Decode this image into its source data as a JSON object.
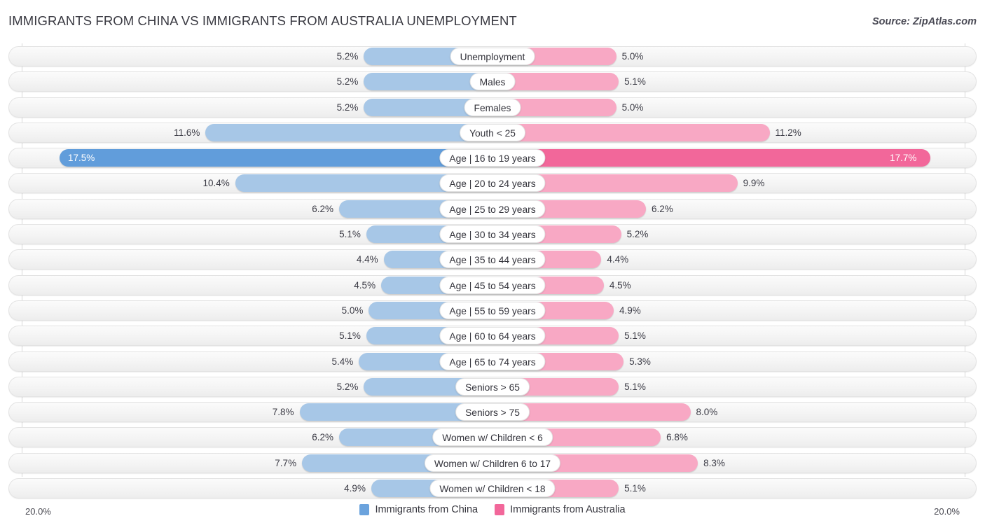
{
  "header": {
    "title": "IMMIGRANTS FROM CHINA VS IMMIGRANTS FROM AUSTRALIA UNEMPLOYMENT",
    "source": "Source: ZipAtlas.com"
  },
  "axis": {
    "left_label": "20.0%",
    "right_label": "20.0%",
    "max": 20.0
  },
  "legend": {
    "items": [
      {
        "label": "Immigrants from China",
        "color": "#6ba3dd"
      },
      {
        "label": "Immigrants from Australia",
        "color": "#f2679a"
      }
    ]
  },
  "colors": {
    "left_normal": "#a7c7e7",
    "left_highlight": "#619ddb",
    "right_normal": "#f8a8c4",
    "right_highlight": "#f2679a",
    "track": "#f4f4f4",
    "gridline": "#d7d7d7"
  },
  "chart_data": {
    "type": "bar",
    "orientation": "horizontal-diverging",
    "title": "IMMIGRANTS FROM CHINA VS IMMIGRANTS FROM AUSTRALIA UNEMPLOYMENT",
    "xlabel": "",
    "ylabel": "",
    "xlim": [
      0,
      20.0
    ],
    "grid": true,
    "legend_position": "bottom-center",
    "categories": [
      "Unemployment",
      "Males",
      "Females",
      "Youth < 25",
      "Age | 16 to 19 years",
      "Age | 20 to 24 years",
      "Age | 25 to 29 years",
      "Age | 30 to 34 years",
      "Age | 35 to 44 years",
      "Age | 45 to 54 years",
      "Age | 55 to 59 years",
      "Age | 60 to 64 years",
      "Age | 65 to 74 years",
      "Seniors > 65",
      "Seniors > 75",
      "Women w/ Children < 6",
      "Women w/ Children 6 to 17",
      "Women w/ Children < 18"
    ],
    "series": [
      {
        "name": "Immigrants from China",
        "values": [
          5.2,
          5.2,
          5.2,
          11.6,
          17.5,
          10.4,
          6.2,
          5.1,
          4.4,
          4.5,
          5.0,
          5.1,
          5.4,
          5.2,
          7.8,
          6.2,
          7.7,
          4.9
        ],
        "labels": [
          "5.2%",
          "5.2%",
          "5.2%",
          "11.6%",
          "17.5%",
          "10.4%",
          "6.2%",
          "5.1%",
          "4.4%",
          "4.5%",
          "5.0%",
          "5.1%",
          "5.4%",
          "5.2%",
          "7.8%",
          "6.2%",
          "7.7%",
          "4.9%"
        ]
      },
      {
        "name": "Immigrants from Australia",
        "values": [
          5.0,
          5.1,
          5.0,
          11.2,
          17.7,
          9.9,
          6.2,
          5.2,
          4.4,
          4.5,
          4.9,
          5.1,
          5.3,
          5.1,
          8.0,
          6.8,
          8.3,
          5.1
        ],
        "labels": [
          "5.0%",
          "5.1%",
          "5.0%",
          "11.2%",
          "17.7%",
          "9.9%",
          "6.2%",
          "5.2%",
          "4.4%",
          "4.5%",
          "4.9%",
          "5.1%",
          "5.3%",
          "5.1%",
          "8.0%",
          "6.8%",
          "8.3%",
          "5.1%"
        ]
      }
    ],
    "highlight_row_index": 4
  }
}
